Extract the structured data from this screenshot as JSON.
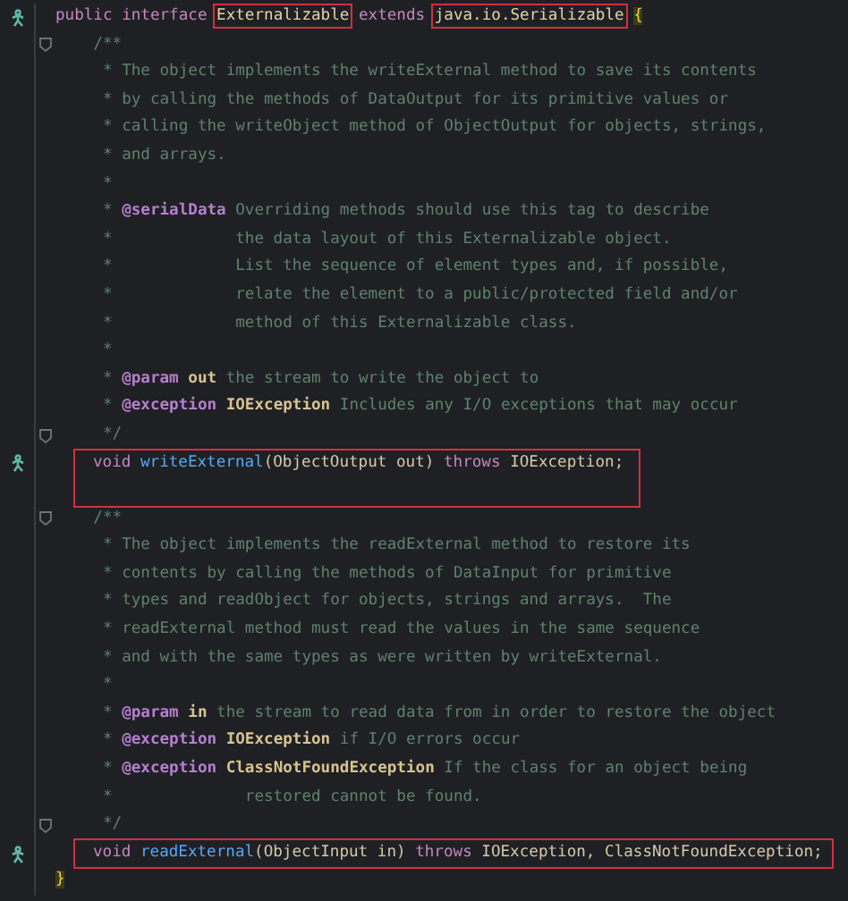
{
  "lines": [
    {
      "kind": "line",
      "marker": true,
      "tokens": [
        {
          "text": "public ",
          "kind": "kw"
        },
        {
          "text": "interface ",
          "kind": "kw"
        },
        {
          "text": "Externalizable",
          "kind": "type",
          "boxed": true
        },
        {
          "text": " extends ",
          "kind": "kw"
        },
        {
          "text": "java.io.Serializable",
          "kind": "type",
          "boxed": true
        },
        {
          "text": "{",
          "kind": "brace"
        }
      ]
    },
    {
      "kind": "line",
      "fold": true,
      "tokens": [
        {
          "text": "    /**",
          "kind": "doc"
        }
      ]
    },
    {
      "kind": "line",
      "tokens": [
        {
          "text": "     * The object implements the writeExternal method to save its contents",
          "kind": "doc"
        }
      ]
    },
    {
      "kind": "line",
      "tokens": [
        {
          "text": "     * by calling the methods of DataOutput for its primitive values or",
          "kind": "doc"
        }
      ]
    },
    {
      "kind": "line",
      "tokens": [
        {
          "text": "     * calling the writeObject method of ObjectOutput for objects, strings,",
          "kind": "doc"
        }
      ]
    },
    {
      "kind": "line",
      "tokens": [
        {
          "text": "     * and arrays.",
          "kind": "doc"
        }
      ]
    },
    {
      "kind": "line",
      "tokens": [
        {
          "text": "     *",
          "kind": "doc"
        }
      ]
    },
    {
      "kind": "line",
      "tokens": [
        {
          "text": "     * ",
          "kind": "doc"
        },
        {
          "text": "@serialData",
          "kind": "tag"
        },
        {
          "text": " Overriding methods should use this tag to describe",
          "kind": "doc"
        }
      ]
    },
    {
      "kind": "line",
      "tokens": [
        {
          "text": "     *             the data layout of this Externalizable object.",
          "kind": "doc"
        }
      ]
    },
    {
      "kind": "line",
      "tokens": [
        {
          "text": "     *             List the sequence of element types and, if possible,",
          "kind": "doc"
        }
      ]
    },
    {
      "kind": "line",
      "tokens": [
        {
          "text": "     *             relate the element to a public/protected field and/or",
          "kind": "doc"
        }
      ]
    },
    {
      "kind": "line",
      "tokens": [
        {
          "text": "     *             method of this Externalizable class.",
          "kind": "doc"
        }
      ]
    },
    {
      "kind": "line",
      "tokens": [
        {
          "text": "     *",
          "kind": "doc"
        }
      ]
    },
    {
      "kind": "line",
      "tokens": [
        {
          "text": "     * ",
          "kind": "doc"
        },
        {
          "text": "@param",
          "kind": "tag"
        },
        {
          "text": " out",
          "kind": "tagref"
        },
        {
          "text": " the stream to write the object to",
          "kind": "doc"
        }
      ]
    },
    {
      "kind": "line",
      "tokens": [
        {
          "text": "     * ",
          "kind": "doc"
        },
        {
          "text": "@exception",
          "kind": "tag"
        },
        {
          "text": " IOException",
          "kind": "tagref"
        },
        {
          "text": " Includes any I/O exceptions that may occur",
          "kind": "doc"
        }
      ]
    },
    {
      "kind": "line",
      "fold": true,
      "tokens": [
        {
          "text": "     */",
          "kind": "doc"
        }
      ]
    },
    {
      "kind": "box",
      "lines": [
        {
          "kind": "line",
          "marker": true,
          "tokens": [
            {
              "text": "void ",
              "kind": "kw"
            },
            {
              "text": "writeExternal",
              "kind": "method"
            },
            {
              "text": "(ObjectOutput out) ",
              "kind": "plain"
            },
            {
              "text": "throws ",
              "kind": "kw"
            },
            {
              "text": "IOException;",
              "kind": "plain"
            }
          ]
        },
        {
          "kind": "line"
        }
      ]
    },
    {
      "kind": "line",
      "fold": true,
      "tokens": [
        {
          "text": "    /**",
          "kind": "doc"
        }
      ]
    },
    {
      "kind": "line",
      "tokens": [
        {
          "text": "     * The object implements the readExternal method to restore its",
          "kind": "doc"
        }
      ]
    },
    {
      "kind": "line",
      "tokens": [
        {
          "text": "     * contents by calling the methods of DataInput for primitive",
          "kind": "doc"
        }
      ]
    },
    {
      "kind": "line",
      "tokens": [
        {
          "text": "     * types and readObject for objects, strings and arrays.  The",
          "kind": "doc"
        }
      ]
    },
    {
      "kind": "line",
      "tokens": [
        {
          "text": "     * readExternal method must read the values in the same sequence",
          "kind": "doc"
        }
      ]
    },
    {
      "kind": "line",
      "tokens": [
        {
          "text": "     * and with the same types as were written by writeExternal.",
          "kind": "doc"
        }
      ]
    },
    {
      "kind": "line",
      "tokens": [
        {
          "text": "     *",
          "kind": "doc"
        }
      ]
    },
    {
      "kind": "line",
      "tokens": [
        {
          "text": "     * ",
          "kind": "doc"
        },
        {
          "text": "@param",
          "kind": "tag"
        },
        {
          "text": " in",
          "kind": "tagref"
        },
        {
          "text": " the stream to read data from in order to restore the object",
          "kind": "doc"
        }
      ]
    },
    {
      "kind": "line",
      "tokens": [
        {
          "text": "     * ",
          "kind": "doc"
        },
        {
          "text": "@exception",
          "kind": "tag"
        },
        {
          "text": " IOException",
          "kind": "tagref"
        },
        {
          "text": " if I/O errors occur",
          "kind": "doc"
        }
      ]
    },
    {
      "kind": "line",
      "tokens": [
        {
          "text": "     * ",
          "kind": "doc"
        },
        {
          "text": "@exception",
          "kind": "tag"
        },
        {
          "text": " ClassNotFoundException",
          "kind": "tagref"
        },
        {
          "text": " If the class for an object being",
          "kind": "doc"
        }
      ]
    },
    {
      "kind": "line",
      "tokens": [
        {
          "text": "     *              restored cannot be found.",
          "kind": "doc"
        }
      ]
    },
    {
      "kind": "line",
      "fold": true,
      "tokens": [
        {
          "text": "     */",
          "kind": "doc"
        }
      ]
    },
    {
      "kind": "box",
      "lines": [
        {
          "kind": "line",
          "marker": true,
          "tokens": [
            {
              "text": "void ",
              "kind": "kw"
            },
            {
              "text": "readExternal",
              "kind": "method"
            },
            {
              "text": "(ObjectInput in) ",
              "kind": "plain"
            },
            {
              "text": "throws ",
              "kind": "kw"
            },
            {
              "text": "IOException, ClassNotFoundException;",
              "kind": "plain"
            }
          ]
        }
      ]
    },
    {
      "kind": "line",
      "tokens": [
        {
          "text": "}",
          "kind": "brace"
        }
      ]
    }
  ]
}
